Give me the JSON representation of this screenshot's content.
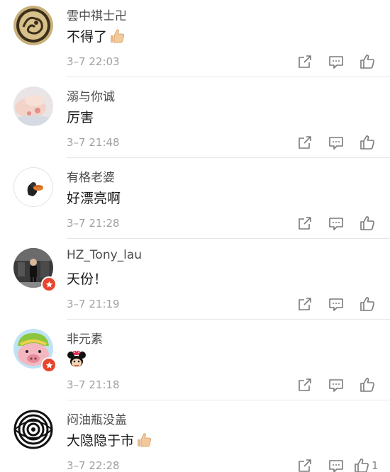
{
  "comments": [
    {
      "name": "雲中祺士卍",
      "text": "不得了",
      "time": "3–7 22:03"
    },
    {
      "name": "溺与你诚",
      "text": "厉害",
      "time": "3–7 21:48"
    },
    {
      "name": "有格老婆",
      "text": "好漂亮啊",
      "time": "3–7 21:28"
    },
    {
      "name": "HZ_Tony_lau",
      "text": "天份！",
      "time": "3–7 21:19"
    },
    {
      "name": "非元素",
      "text": "",
      "time": "3–7 21:18"
    },
    {
      "name": "闷油瓶没盖",
      "text": "大隐隐于市",
      "time": "3–7 22:28",
      "likes": "1"
    }
  ],
  "colors": {
    "badge": "#e8452e",
    "icon": "#7a7a7a",
    "time": "#a0a0a0"
  },
  "icons": {
    "share": "share-icon",
    "comment": "comment-icon",
    "like": "thumbs-up-icon"
  }
}
